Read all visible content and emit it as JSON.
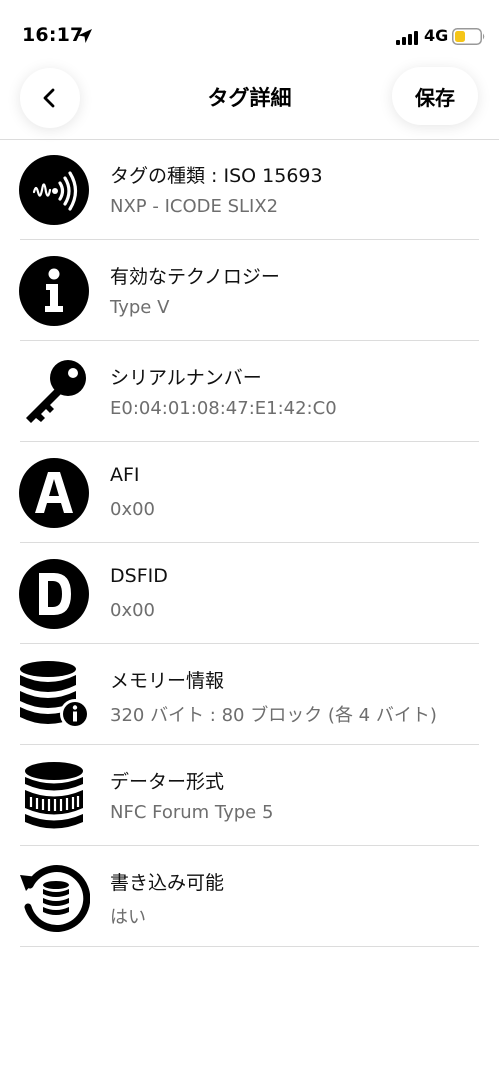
{
  "status_bar": {
    "time": "16:17",
    "network": "4G",
    "battery_color": "#f5c518"
  },
  "nav": {
    "title": "タグ詳細",
    "save_label": "保存"
  },
  "items": [
    {
      "icon": "nfc-signal-icon",
      "title": "タグの種類 : ISO 15693",
      "value": "NXP - ICODE SLIX2"
    },
    {
      "icon": "info-icon",
      "title": "有効なテクノロジー",
      "value": "Type V"
    },
    {
      "icon": "key-icon",
      "title": "シリアルナンバー",
      "value": "E0:04:01:08:47:E1:42:C0"
    },
    {
      "icon": "letter-a-icon",
      "title": "AFI",
      "value": "0x00"
    },
    {
      "icon": "letter-d-icon",
      "title": "DSFID",
      "value": "0x00"
    },
    {
      "icon": "database-info-icon",
      "title": "メモリー情報",
      "value": "320 バイト : 80 ブロック (各 4 バイト)"
    },
    {
      "icon": "database-format-icon",
      "title": "データー形式",
      "value": "NFC Forum Type 5"
    },
    {
      "icon": "rewrite-database-icon",
      "title": "書き込み可能",
      "value": "はい"
    }
  ]
}
